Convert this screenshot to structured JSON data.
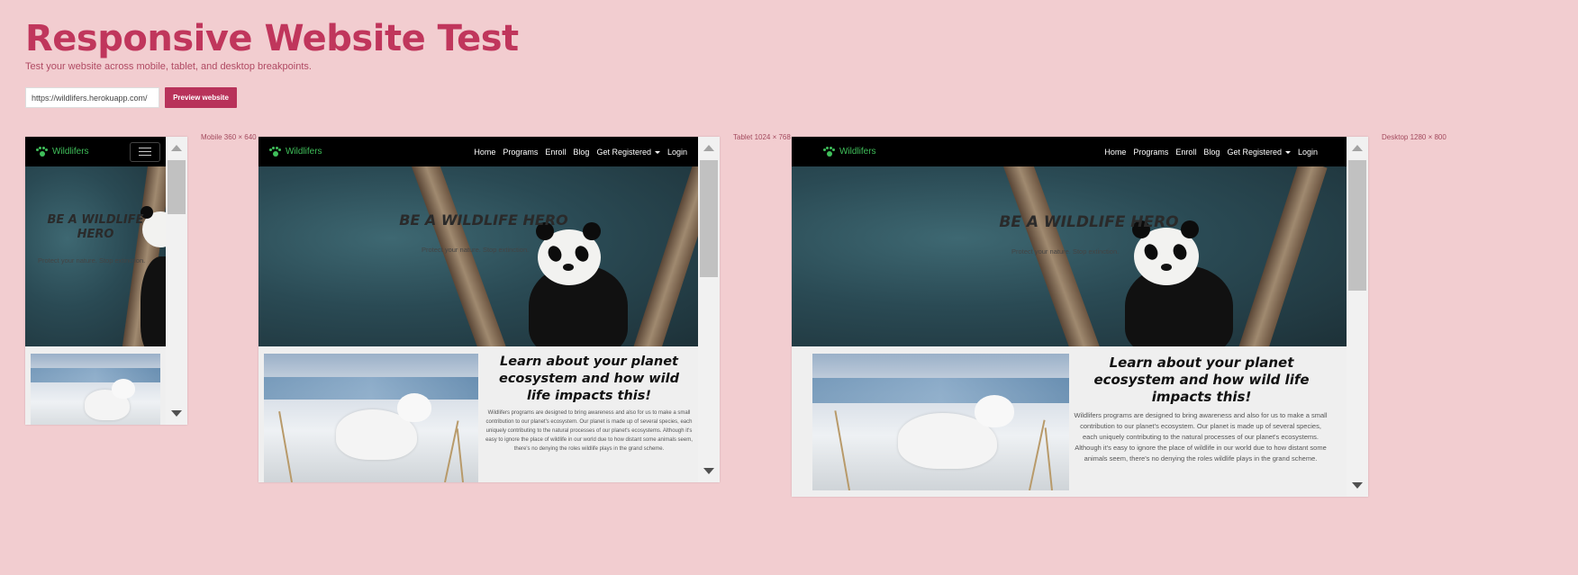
{
  "header": {
    "title": "Responsive Website Test",
    "subtitle": "Test your website across mobile, tablet, and desktop breakpoints."
  },
  "controls": {
    "url_value": "https://wildlifers.herokuapp.com/",
    "preview_label": "Preview website"
  },
  "frames": {
    "mobile_label": "Mobile 360 × 640",
    "tablet_label": "Tablet 1024 × 768",
    "desktop_label": "Desktop 1280 × 800"
  },
  "site": {
    "brand": "Wildlifers",
    "nav": [
      "Home",
      "Programs",
      "Enroll",
      "Blog",
      "Get Registered",
      "Login"
    ],
    "hero_title": "BE A WILDLIFE HERO",
    "hero_tagline": "Protect your nature. Stop extinction.",
    "about_title": "Learn about your planet ecosystem and how wild life impacts this!",
    "about_text": "Wildlifers programs are designed to bring awareness and also for us to make a small contribution to our planet's ecosystem. Our planet is made up of several species, each uniquely contributing to the natural processes of our planet's ecosystems. Although it's easy to ignore the place of wildlife in our world due to how distant some animals seem, there's no denying the roles wildlife plays in the grand scheme."
  },
  "colors": {
    "background": "#f2cdd0",
    "title": "#c0365c",
    "button": "#b8325a",
    "brand_green": "#3fbf5a"
  },
  "icons": [
    "paw-icon",
    "hamburger-menu-icon",
    "dropdown-caret-icon",
    "scroll-up-arrow-icon",
    "scroll-down-arrow-icon"
  ]
}
